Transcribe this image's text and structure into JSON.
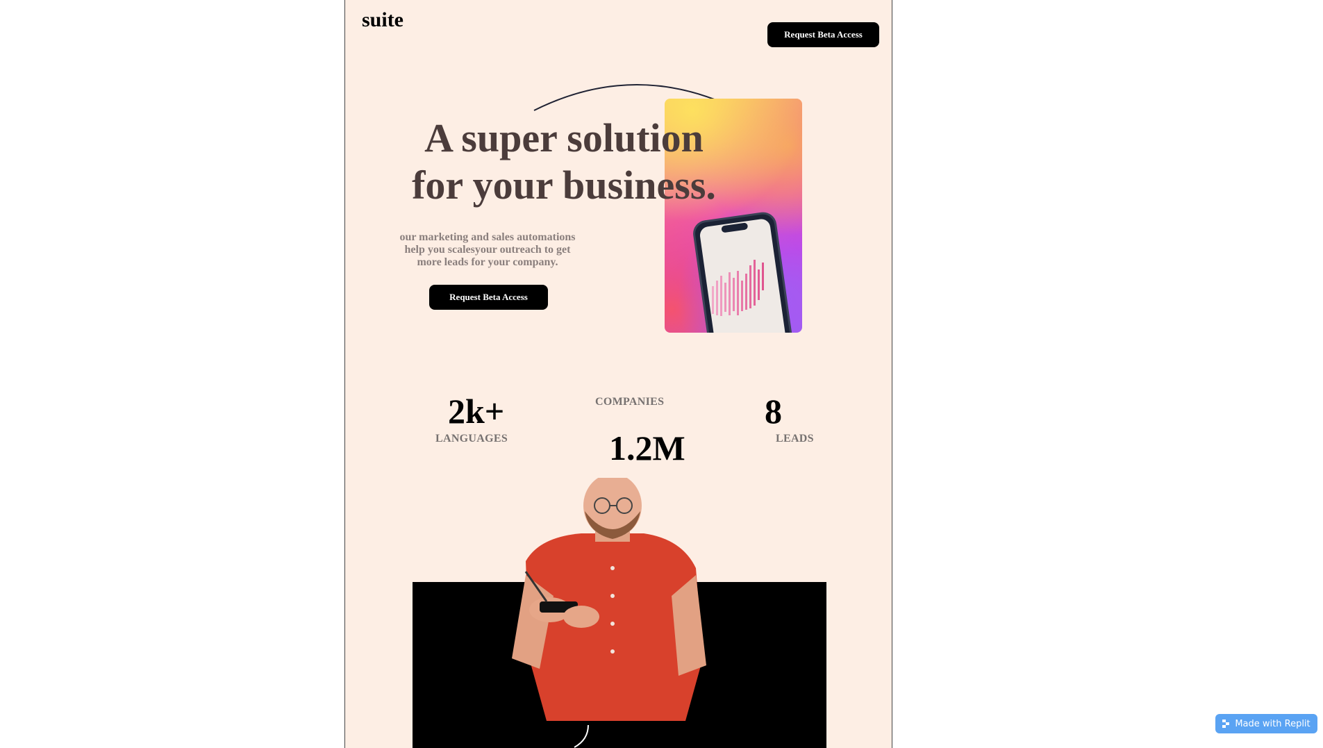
{
  "header": {
    "brand": "suite",
    "cta_label": "Request Beta Access"
  },
  "hero": {
    "title_line1": "A super solution",
    "title_line2": "for your business.",
    "subtitle": "our marketing and sales automations help you scalesyour outreach to get more leads for your company.",
    "cta_label": "Request Beta Access",
    "gradient_colors": [
      "#fde05f",
      "#f6a263",
      "#ef5ba7",
      "#d23ce0",
      "#9e5cf4",
      "#f4536f"
    ]
  },
  "stats": [
    {
      "value": "2k+",
      "label": "LANGUAGES"
    },
    {
      "value": "1.2M",
      "label": "COMPANIES"
    },
    {
      "value": "8",
      "label": "LEADS"
    }
  ],
  "badge": {
    "label": "Made with Replit",
    "color": "#5aa3f3"
  },
  "colors": {
    "page_bg": "#fdeee4",
    "title": "#4b3c3b",
    "button_bg": "#000000"
  }
}
